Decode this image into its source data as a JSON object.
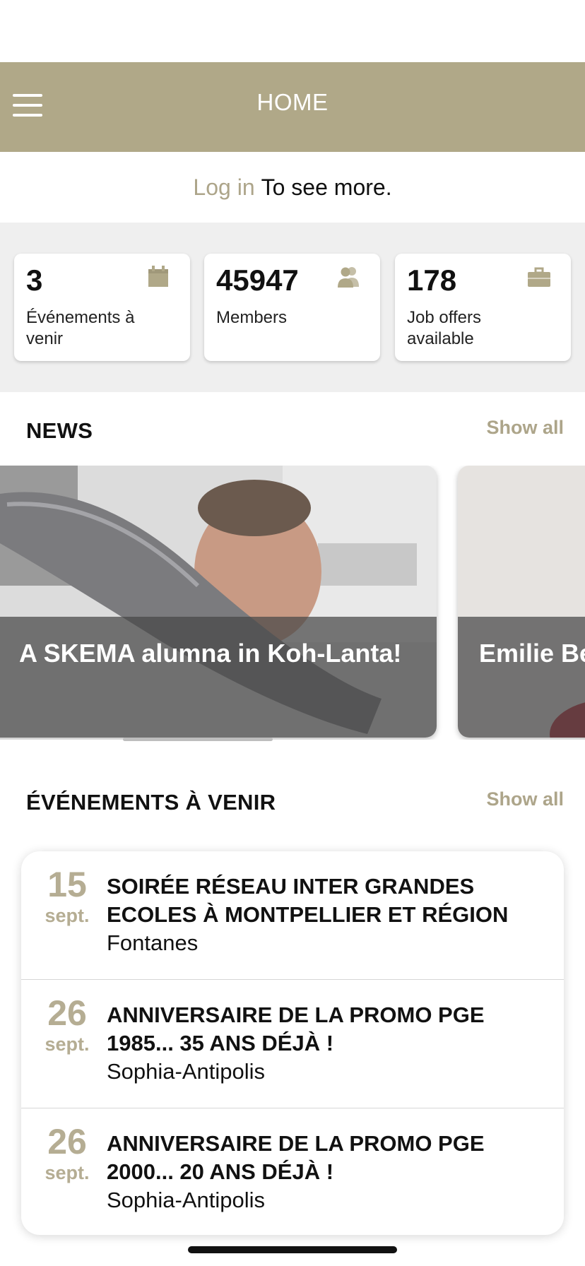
{
  "header": {
    "title": "HOME"
  },
  "login_banner": {
    "link": "Log in",
    "text": "To see more."
  },
  "stats": [
    {
      "value": "3",
      "label": "Événements à venir",
      "icon": "calendar-icon"
    },
    {
      "value": "45947",
      "label": "Members",
      "icon": "members-icon"
    },
    {
      "value": "178",
      "label": "Job offers available",
      "icon": "briefcase-icon"
    }
  ],
  "news": {
    "title": "NEWS",
    "show_all": "Show all",
    "items": [
      {
        "title": "A SKEMA alumna in Koh-Lanta!"
      },
      {
        "title": "Emilie Be an intern"
      }
    ]
  },
  "events": {
    "title": "ÉVÉNEMENTS À VENIR",
    "show_all": "Show all",
    "items": [
      {
        "day": "15",
        "month": "sept.",
        "title": "SOIRÉE RÉSEAU INTER GRANDES ECOLES À MONTPELLIER ET RÉGION",
        "place": "Fontanes"
      },
      {
        "day": "26",
        "month": "sept.",
        "title": "ANNIVERSAIRE DE LA PROMO PGE 1985... 35 ANS DÉJÀ !",
        "place": "Sophia-Antipolis"
      },
      {
        "day": "26",
        "month": "sept.",
        "title": "ANNIVERSAIRE DE LA PROMO PGE 2000... 20 ANS DÉJÀ !",
        "place": "Sophia-Antipolis"
      }
    ]
  },
  "colors": {
    "header_bg": "#b0a888",
    "accent": "#ada58a",
    "stats_bg": "#efefef"
  }
}
